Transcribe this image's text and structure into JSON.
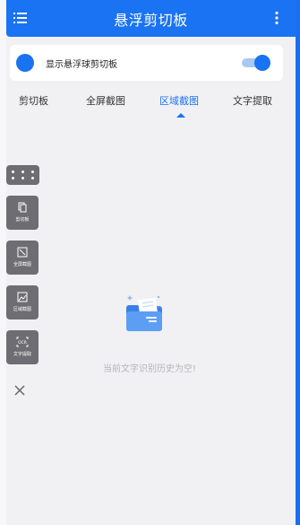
{
  "appbar": {
    "title": "悬浮剪切板",
    "menu_icon": "menu-icon",
    "more_icon": "more-vertical-icon"
  },
  "toggle_card": {
    "label": "显示悬浮球剪切板",
    "enabled": true
  },
  "tabs": [
    {
      "label": "剪切板",
      "active": false
    },
    {
      "label": "全屏截图",
      "active": false
    },
    {
      "label": "区域截图",
      "active": true
    },
    {
      "label": "文字提取",
      "active": false
    }
  ],
  "floating_toolbar": {
    "buttons": [
      {
        "label": "剪切板",
        "icon": "clipboard-icon"
      },
      {
        "label": "全屏截图",
        "icon": "fullscreen-screenshot-icon"
      },
      {
        "label": "区域截图",
        "icon": "region-screenshot-icon"
      },
      {
        "label": "文字提取",
        "icon": "ocr-icon"
      }
    ],
    "close_icon": "close-icon"
  },
  "empty_state": {
    "text": "当前文字识别历史为空!",
    "icon": "empty-folder-icon"
  },
  "colors": {
    "primary": "#1a73f2",
    "background": "#f1f1f4",
    "toolbar": "#6e6e72"
  }
}
